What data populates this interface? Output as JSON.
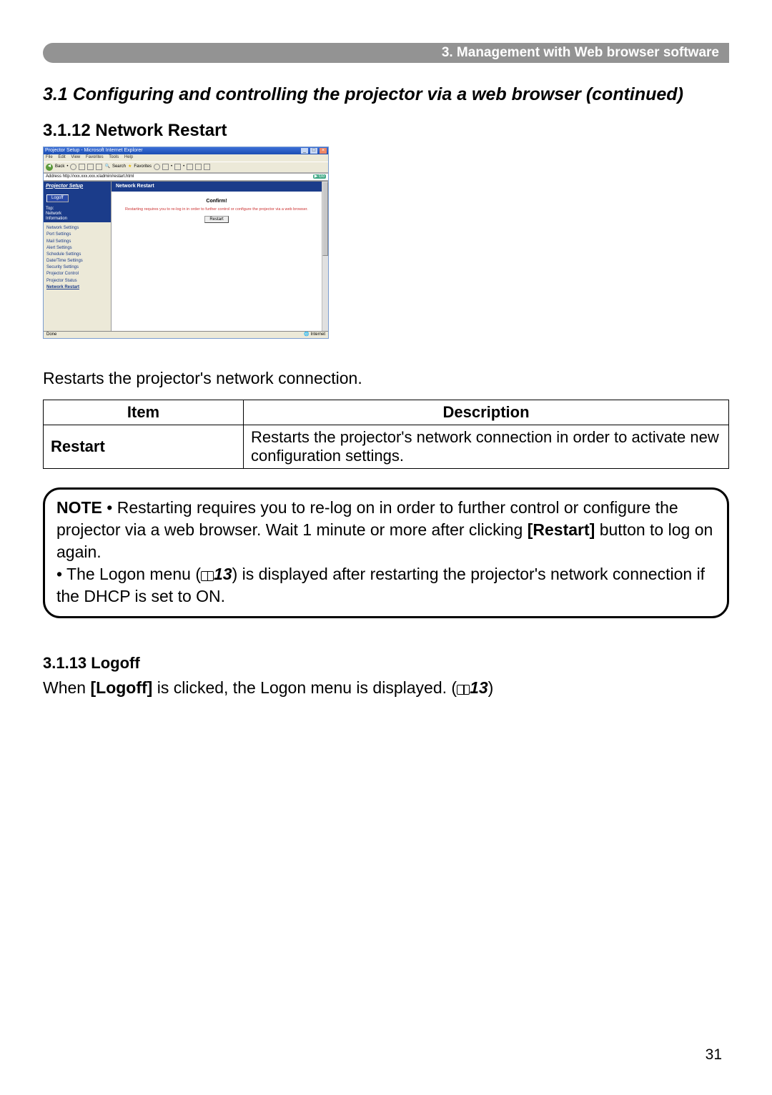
{
  "header_bar": "3. Management with Web browser software",
  "section_title": "3.1 Configuring and controlling the projector via a web browser (continued)",
  "sub_3_1_12_heading": "3.1.12 Network Restart",
  "restarts_line": "Restarts the projector's network connection.",
  "table": {
    "header_item": "Item",
    "header_desc": "Description",
    "row_item": "Restart",
    "row_desc": "Restarts the projector's network connection in order to activate new configuration settings."
  },
  "note": {
    "label": "NOTE",
    "part1": "• Restarting requires you to re-log on in order to further control or configure the projector via a web browser. Wait 1 minute or more after clicking ",
    "restart_bold": "[Restart]",
    "part1b": " button to log on again.",
    "part2a": "• The Logon menu (",
    "ref1": "13",
    "part2b": ") is displayed after restarting the projector's network connection if the DHCP is set to ON."
  },
  "sub_3_1_13_heading": "3.1.13 Logoff",
  "logoff_line_a": "When ",
  "logoff_bold": "[Logoff]",
  "logoff_line_b": " is clicked, the Logon menu is displayed. (",
  "logoff_ref": "13",
  "logoff_line_c": ")",
  "page_number": "31",
  "screenshot": {
    "window_title": "Projector Setup - Microsoft Internet Explorer",
    "menu": {
      "file": "File",
      "edit": "Edit",
      "view": "View",
      "favorites": "Favorites",
      "tools": "Tools",
      "help": "Help"
    },
    "toolbar": {
      "back": "Back",
      "search": "Search",
      "favorites": "Favorites"
    },
    "address_label": "Address",
    "address_url": "http://xxx.xxx.xxx.x/admin/restart.html",
    "go": "Go",
    "sidebar_title": "Projector Setup",
    "logoff_btn": "Logoff",
    "top": "Top:",
    "network": "Network",
    "information": "Information",
    "items": {
      "network_settings": "Network Settings",
      "port_settings": "Port Settings",
      "mail_settings": "Mail Settings",
      "alert_settings": "Alert Settings",
      "schedule_settings": "Schedule Settings",
      "datetime_settings": "Date/Time Settings",
      "security_settings": "Security Settings",
      "projector_control": "Projector Control",
      "projector_status": "Projector Status",
      "network_restart": "Network Restart"
    },
    "main_header": "Network Restart",
    "confirm": "Confirm!",
    "confirm_text": "Restarting requires you to re-log in in order to further control or configure the projector via a web browser.",
    "restart_btn": "Restart",
    "status_done": "Done",
    "status_internet": "Internet"
  }
}
